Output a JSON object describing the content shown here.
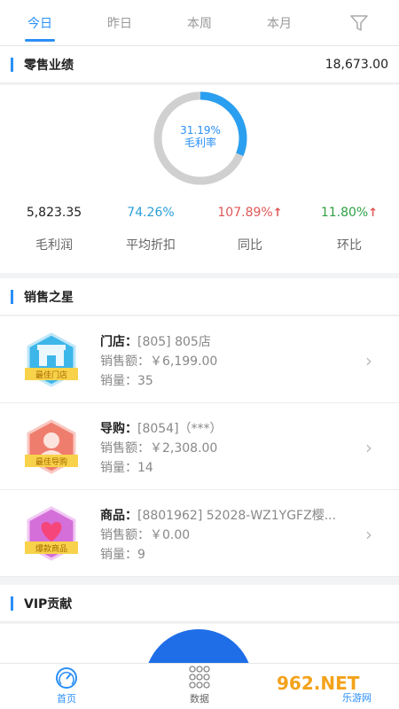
{
  "tabs": [
    "今日",
    "昨日",
    "本周",
    "本月"
  ],
  "filter_icon": "filter-icon",
  "performance": {
    "title": "零售业绩",
    "total": "18,673.00",
    "gross_margin_pct": "31.19%",
    "gross_margin_label": "毛利率",
    "gross_margin_value": 0.3119,
    "stats": [
      {
        "value": "5,823.35",
        "label": "毛利润",
        "color": "#222222"
      },
      {
        "value": "74.26%",
        "label": "平均折扣",
        "color": "#2a9fd8"
      },
      {
        "value": "107.89%",
        "label": "同比",
        "color": "#e05656",
        "arrow": "↑"
      },
      {
        "value": "11.80%",
        "label": "环比",
        "color": "#2ea043",
        "arrow": "↑"
      }
    ]
  },
  "sales_star": {
    "title": "销售之星",
    "items": [
      {
        "name_label": "门店：",
        "name_value": "[805] 805店",
        "amount_label": "销售额：",
        "amount_value": "￥6,199.00",
        "qty_label": "销量：",
        "qty_value": "35",
        "badge": "最佳门店",
        "badge_color": "#3db6ea"
      },
      {
        "name_label": "导购：",
        "name_value": "[8054]（***）",
        "amount_label": "销售额：",
        "amount_value": "￥2,308.00",
        "qty_label": "销量：",
        "qty_value": "14",
        "badge": "最佳导购",
        "badge_color": "#ef7d6e"
      },
      {
        "name_label": "商品：",
        "name_value": "[8801962] 52028-WZ1YGFZ樱...",
        "amount_label": "销售额：",
        "amount_value": "￥0.00",
        "qty_label": "销量：",
        "qty_value": "9",
        "badge": "爆款商品",
        "badge_color": "#d46fd9"
      }
    ]
  },
  "vip": {
    "title": "VIP贡献"
  },
  "bottom_nav": [
    {
      "label": "首页",
      "icon": "speedometer-icon"
    },
    {
      "label": "数据",
      "icon": "grid-dots-icon"
    }
  ],
  "watermark": {
    "text": "962.NET",
    "subtext": "乐游网"
  }
}
